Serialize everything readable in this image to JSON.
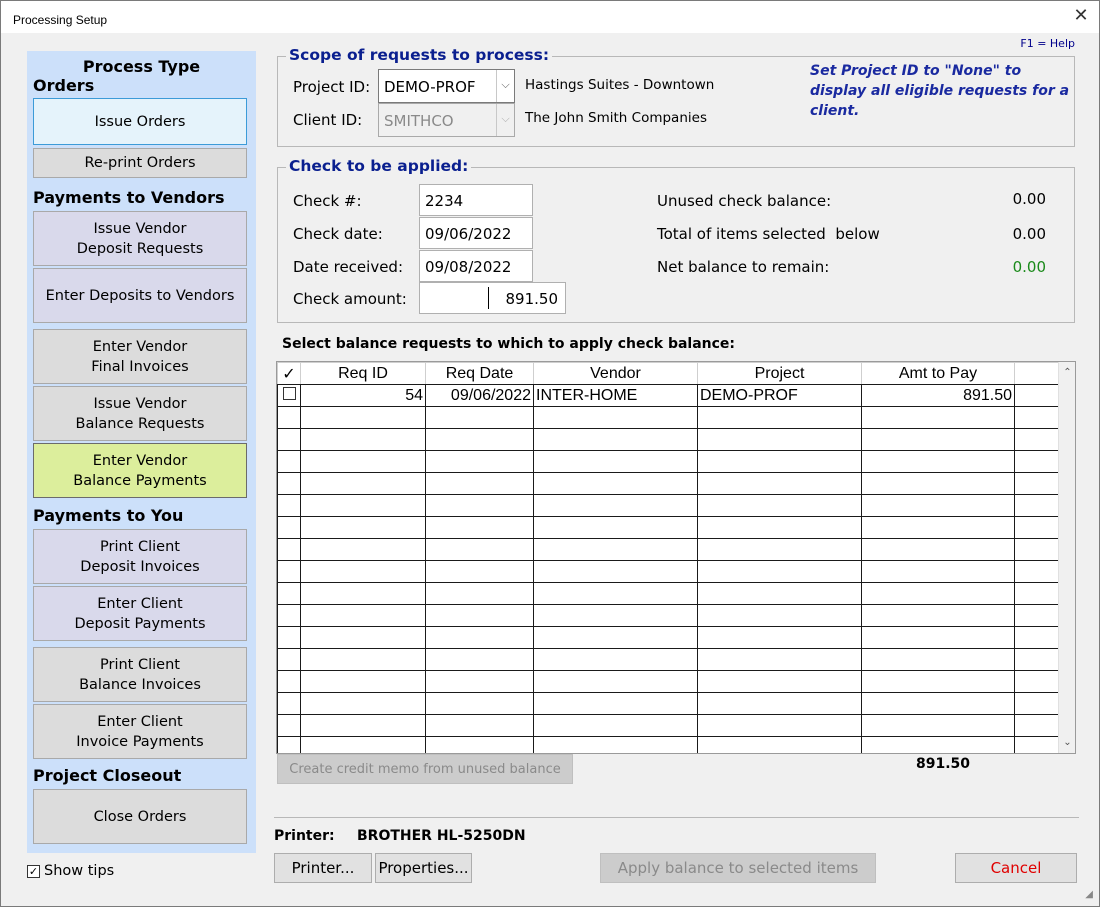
{
  "window": {
    "title": "Processing Setup",
    "help": "F1 = Help",
    "close_glyph": "✕"
  },
  "left": {
    "heading": "Process Type",
    "sections": {
      "orders": "Orders",
      "payments_vendors": "Payments to Vendors",
      "payments_you": "Payments to You",
      "closeout": "Project Closeout"
    },
    "buttons": [
      "Issue Orders",
      "Re-print Orders",
      "Issue Vendor\nDeposit Requests",
      "Enter Deposits to Vendors",
      "Enter Vendor\nFinal Invoices",
      "Issue Vendor\nBalance Requests",
      "Enter Vendor\nBalance Payments",
      "Print Client\nDeposit Invoices",
      "Enter Client\nDeposit Payments",
      "Print Client\nBalance Invoices",
      "Enter Client\nInvoice Payments",
      "Close Orders"
    ],
    "show_tips_label": "Show tips",
    "show_tips_checked": true
  },
  "scope": {
    "title": "Scope of requests to process:",
    "project_label": "Project ID:",
    "project_value": "DEMO-PROF",
    "project_name": "Hastings Suites - Downtown",
    "client_label": "Client ID:",
    "client_value": "SMITHCO",
    "client_name": "The John Smith Companies",
    "hint": "Set Project ID to \"None\" to display all eligible requests for a client."
  },
  "check": {
    "title": "Check to be applied:",
    "number_label": "Check #:",
    "number_value": "2234",
    "date_label": "Check date:",
    "date_value": "09/06/2022",
    "received_label": "Date received:",
    "received_value": "09/08/2022",
    "amount_label": "Check amount:",
    "amount_value": "891.50",
    "unused_label": "Unused check balance:",
    "unused_value": "0.00",
    "total_label": "Total of items selected  below",
    "total_value": "0.00",
    "net_label": "Net balance to remain:",
    "net_value": "0.00",
    "net_color": "#1a8a1a"
  },
  "grid": {
    "caption": "Select balance requests to which to apply check balance:",
    "columns": [
      "✓",
      "Req ID",
      "Req Date",
      "Vendor",
      "Project",
      "Amt to Pay"
    ],
    "rows": [
      {
        "checked": false,
        "req_id": "54",
        "req_date": "09/06/2022",
        "vendor": "INTER-HOME",
        "project": "DEMO-PROF",
        "amount": "891.50"
      }
    ],
    "total": "891.50",
    "scroll_up": "⌃",
    "scroll_down": "⌄"
  },
  "credit_memo_button": "Create credit memo from unused balance",
  "printer": {
    "label": "Printer:",
    "name": "BROTHER HL-5250DN"
  },
  "bottom_buttons": {
    "printer": "Printer...",
    "properties": "Properties...",
    "apply": "Apply balance to selected items",
    "cancel": "Cancel"
  }
}
